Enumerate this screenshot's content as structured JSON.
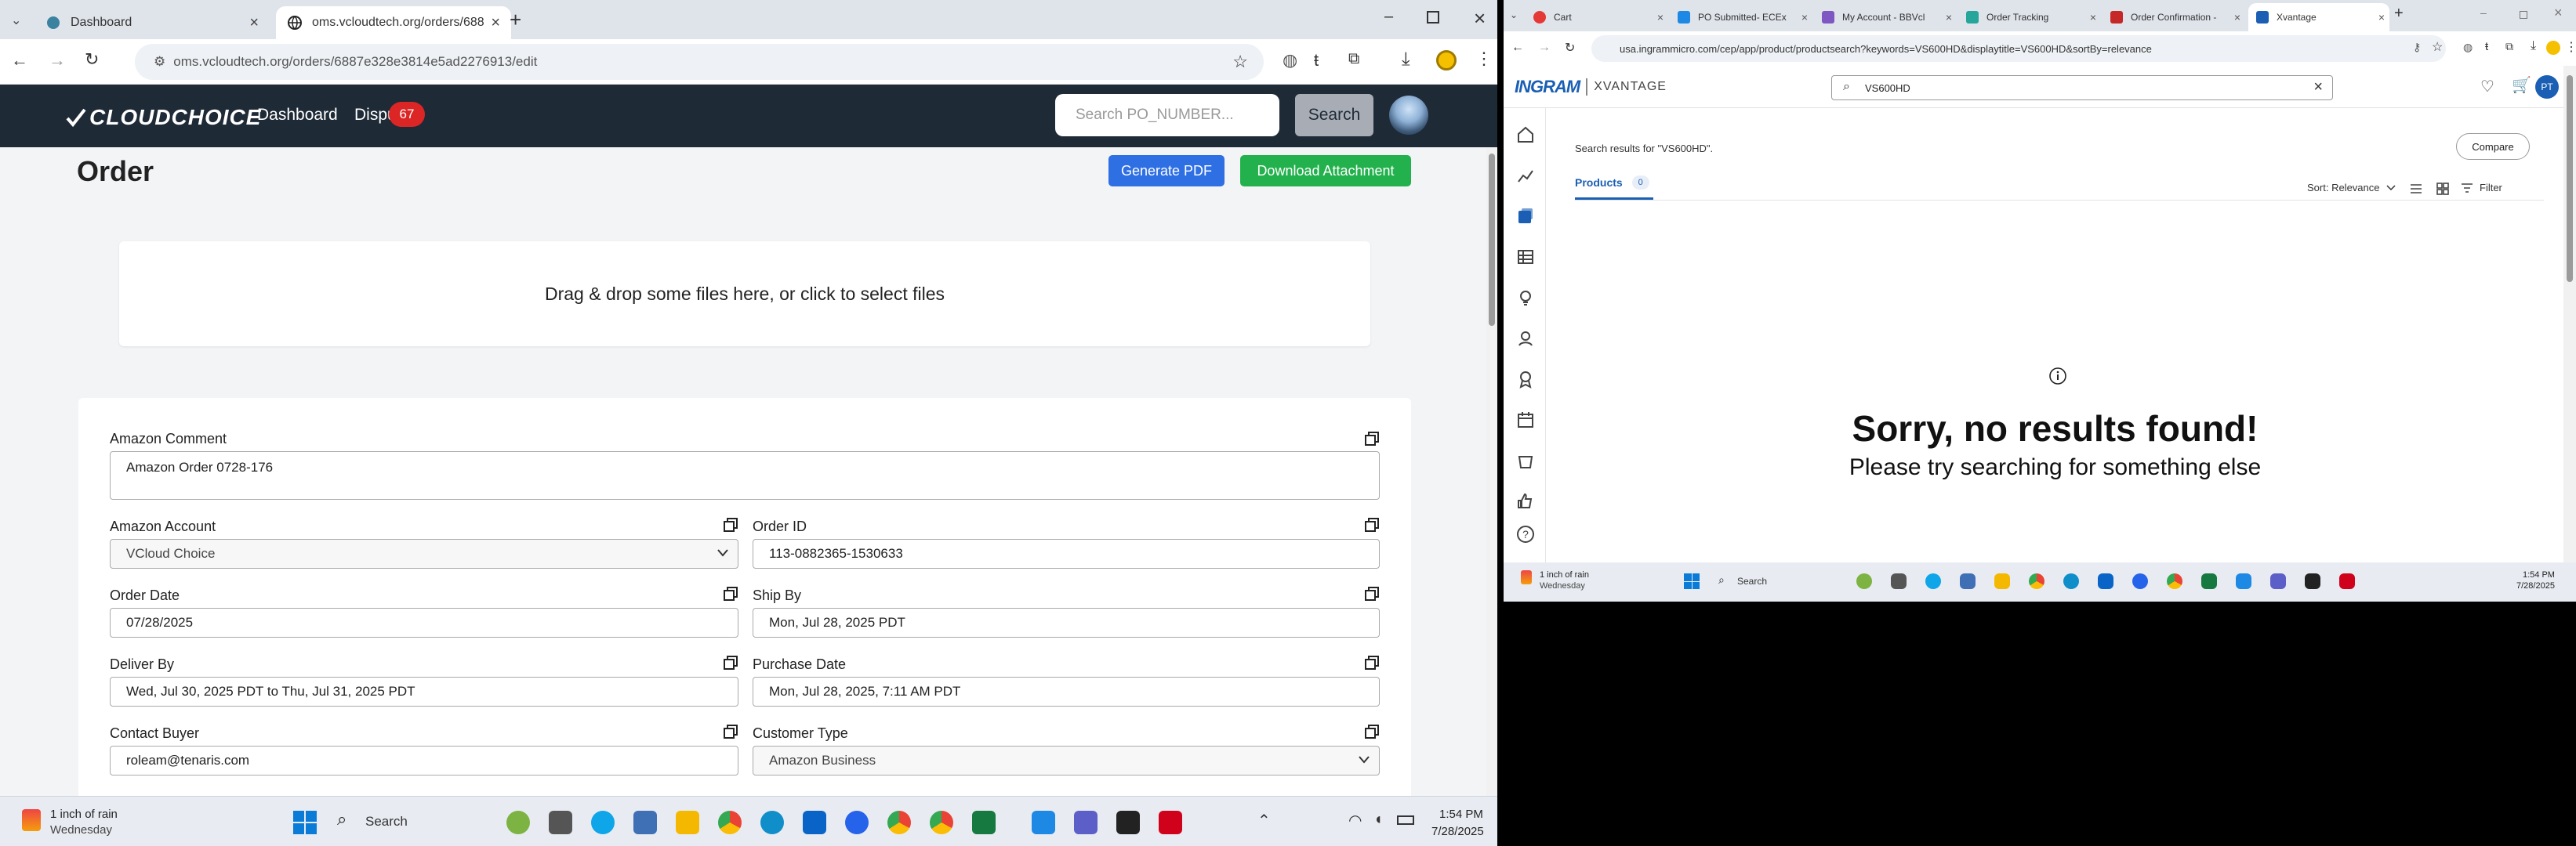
{
  "left_browser": {
    "tabs": [
      {
        "label": "Dashboard"
      },
      {
        "label": "oms.vcloudtech.org/orders/688"
      }
    ],
    "url": "oms.vcloudtech.org/orders/6887e328e3814e5ad2276913/edit",
    "app": {
      "logo_text": "CLOUDCHOICE",
      "nav": {
        "dashboard": "Dashboard",
        "disputes": "Dispu",
        "disputes_badge": "67"
      },
      "search_placeholder": "Search PO_NUMBER...",
      "search_button": "Search"
    },
    "page": {
      "title": "Order",
      "generate_pdf": "Generate PDF",
      "download_attachment": "Download Attachment",
      "dropzone": "Drag & drop some files here, or click to select files"
    },
    "form": {
      "amazon_comment": {
        "label": "Amazon Comment",
        "value": "Amazon Order 0728-176"
      },
      "amazon_account": {
        "label": "Amazon Account",
        "value": "VCloud Choice"
      },
      "order_id": {
        "label": "Order ID",
        "value": "113-0882365-1530633"
      },
      "order_date": {
        "label": "Order Date",
        "value": "07/28/2025"
      },
      "ship_by": {
        "label": "Ship By",
        "value": "Mon, Jul 28, 2025 PDT"
      },
      "deliver_by": {
        "label": "Deliver By",
        "value": "Wed, Jul 30, 2025 PDT to Thu, Jul 31, 2025 PDT"
      },
      "purchase_date": {
        "label": "Purchase Date",
        "value": "Mon, Jul 28, 2025, 7:11 AM PDT"
      },
      "contact_buyer": {
        "label": "Contact Buyer",
        "value": "roleam@tenaris.com"
      },
      "customer_type": {
        "label": "Customer Type",
        "value": "Amazon Business"
      }
    },
    "taskbar": {
      "weather_temp": "1 inch of rain",
      "weather_day": "Wednesday",
      "search": "Search",
      "time": "1:54 PM",
      "date": "7/28/2025"
    }
  },
  "right_browser": {
    "tabs": [
      {
        "label": "Cart"
      },
      {
        "label": "PO Submitted- ECEx"
      },
      {
        "label": "My Account - BBVcl"
      },
      {
        "label": "Order Tracking"
      },
      {
        "label": "Order Confirmation -"
      },
      {
        "label": "Xvantage"
      }
    ],
    "url": "usa.ingrammicro.com/cep/app/product/productsearch?keywords=VS600HD&displaytitle=VS600HD&sortBy=relevance",
    "brand_ingram": "INGRAM",
    "brand_xvantage": "XVANTAGE",
    "search_value": "VS600HD",
    "results_text": "Search results for \"VS600HD\".",
    "compare": "Compare",
    "products_tab": "Products",
    "products_count": "0",
    "sort": "Sort: Relevance",
    "filter": "Filter",
    "no_results_title": "Sorry, no results found!",
    "no_results_sub": "Please try searching for something else",
    "avatar_initials": "PT",
    "taskbar": {
      "weather_temp": "1 inch of rain",
      "weather_day": "Wednesday",
      "search": "Search",
      "time": "1:54 PM",
      "date": "7/28/2025"
    }
  },
  "colors": {
    "app_header": "#1f2a37",
    "primary_blue": "#2f6fe4",
    "success_green": "#22b14c",
    "badge_red": "#dc2626",
    "ingram_blue": "#1a5fb4"
  }
}
